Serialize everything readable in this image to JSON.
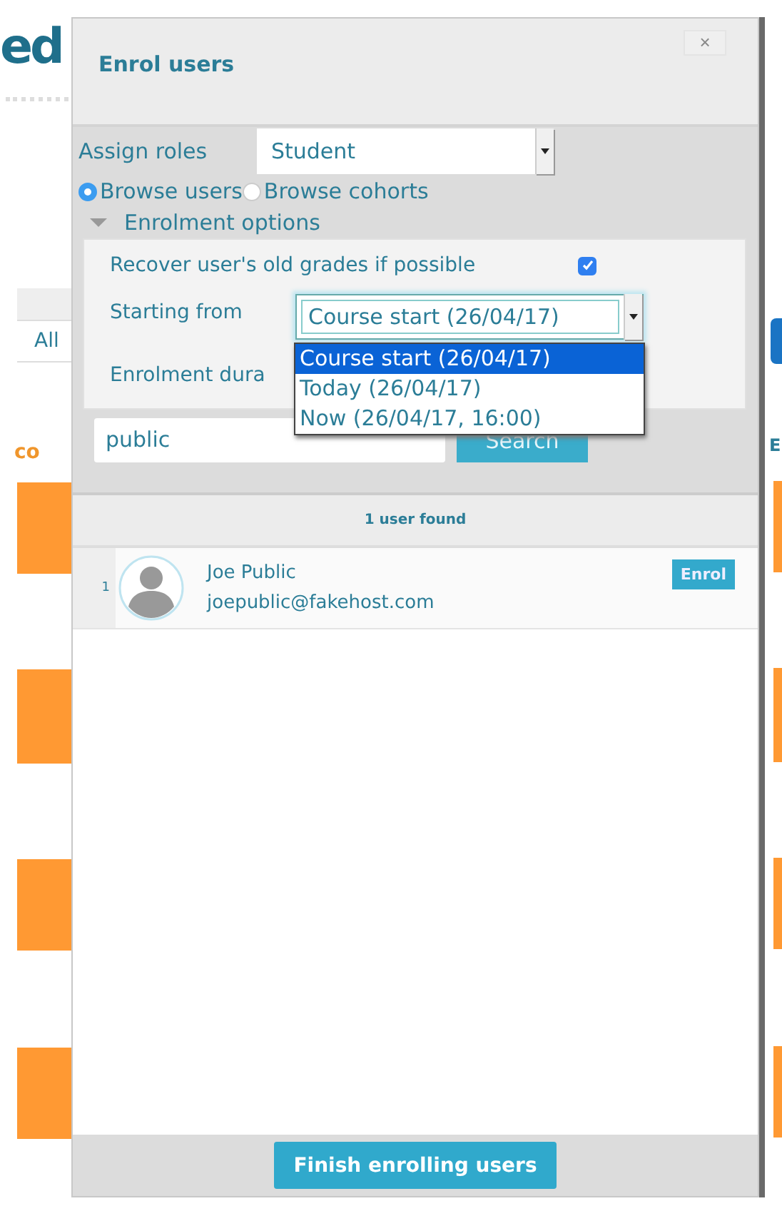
{
  "page": {
    "heading": "ed",
    "tab": "All",
    "section_heading": "co",
    "right_heading": "E"
  },
  "dialog": {
    "title": "Enrol users",
    "close": "×",
    "assign_roles": {
      "label": "Assign roles",
      "value": "Student"
    },
    "browse": [
      {
        "label": "Browse users",
        "selected": true
      },
      {
        "label": "Browse cohorts",
        "selected": false
      }
    ],
    "enrolment_options": {
      "label": "Enrolment options",
      "expanded": true,
      "recover": {
        "label": "Recover user's old grades if possible",
        "checked": true
      },
      "starting_from": {
        "label": "Starting from",
        "value": "Course start (26/04/17)",
        "options": [
          {
            "label": "Course start (26/04/17)",
            "selected": true
          },
          {
            "label": "Today (26/04/17)",
            "selected": false
          },
          {
            "label": "Now (26/04/17, 16:00)",
            "selected": false
          }
        ]
      },
      "duration": {
        "label": "Enrolment dura"
      }
    },
    "search": {
      "value": "public",
      "button": "Search"
    },
    "results": {
      "count": "1 user found",
      "users": [
        {
          "index": "1",
          "name": "Joe Public",
          "email": "joepublic@fakehost.com",
          "action": "Enrol"
        }
      ]
    },
    "finish_button": "Finish enrolling users"
  }
}
